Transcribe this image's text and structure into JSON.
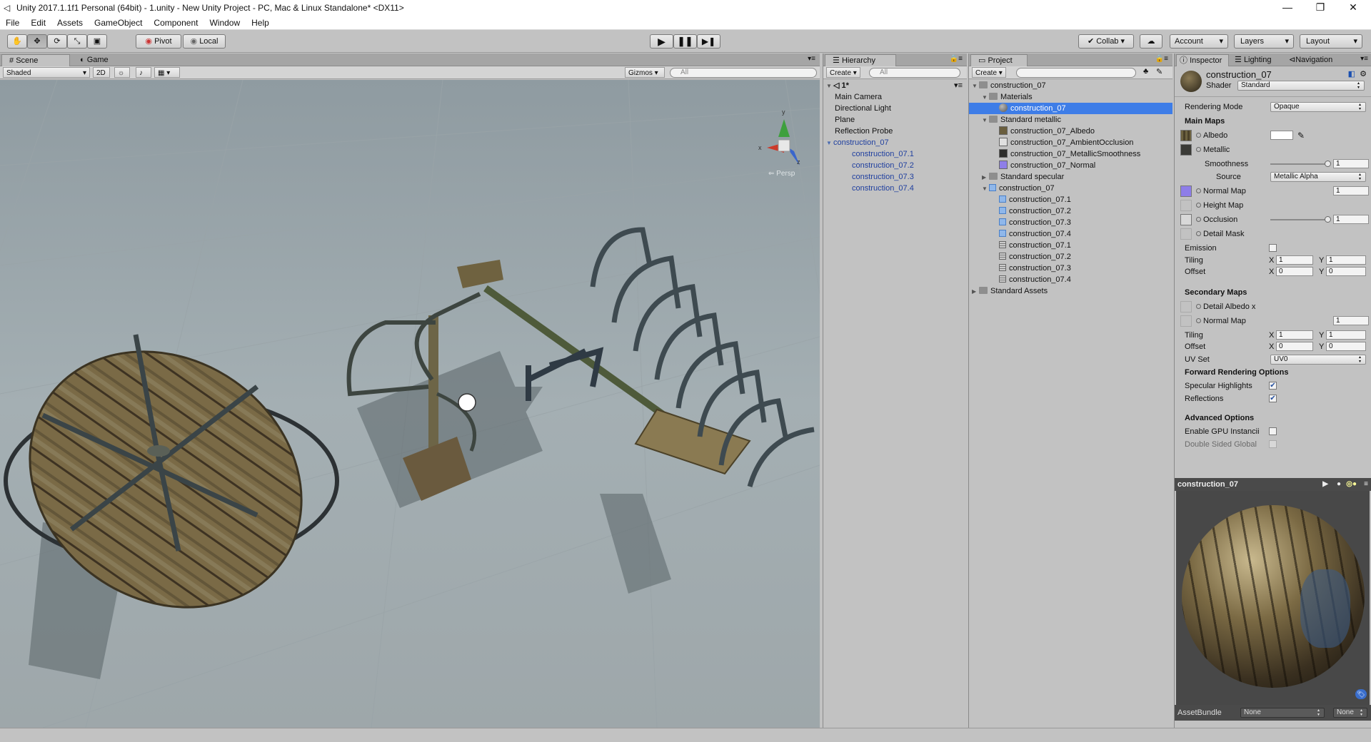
{
  "window": {
    "title": "Unity 2017.1.1f1 Personal (64bit) - 1.unity - New Unity Project - PC, Mac & Linux Standalone* <DX11>",
    "minimize": "—",
    "maximize": "❐",
    "close": "✕"
  },
  "menu": [
    "File",
    "Edit",
    "Assets",
    "GameObject",
    "Component",
    "Window",
    "Help"
  ],
  "toolbar": {
    "pivot": "Pivot",
    "local": "Local",
    "collab": "✔ Collab",
    "account": "Account",
    "layers": "Layers",
    "layout": "Layout"
  },
  "scene": {
    "tab_scene": "Scene",
    "tab_game": "Game",
    "shading": "Shaded",
    "mode_2d": "2D",
    "gizmos": "Gizmos",
    "search_placeholder": "All",
    "persp": "Persp",
    "axis_x": "x",
    "axis_y": "y",
    "axis_z": "z"
  },
  "hierarchy": {
    "tab": "Hierarchy",
    "create": "Create",
    "search_placeholder": "All",
    "scene_name": "1*",
    "items": [
      {
        "label": "Main Camera",
        "blue": false,
        "indent": 1
      },
      {
        "label": "Directional Light",
        "blue": false,
        "indent": 1
      },
      {
        "label": "Plane",
        "blue": false,
        "indent": 1
      },
      {
        "label": "Reflection Probe",
        "blue": false,
        "indent": 1
      },
      {
        "label": "construction_07",
        "blue": true,
        "indent": 1,
        "expanded": true
      },
      {
        "label": "construction_07.1",
        "blue": true,
        "indent": 2
      },
      {
        "label": "construction_07.2",
        "blue": true,
        "indent": 2
      },
      {
        "label": "construction_07.3",
        "blue": true,
        "indent": 2
      },
      {
        "label": "construction_07.4",
        "blue": true,
        "indent": 2
      }
    ]
  },
  "project": {
    "tab": "Project",
    "create": "Create",
    "items": [
      {
        "label": "construction_07",
        "type": "folder",
        "indent": 0,
        "fold": "▼"
      },
      {
        "label": "Materials",
        "type": "folder",
        "indent": 1,
        "fold": "▼"
      },
      {
        "label": "construction_07",
        "type": "material",
        "indent": 2,
        "fold": "",
        "selected": true
      },
      {
        "label": "Standard metallic",
        "type": "folder",
        "indent": 1,
        "fold": "▼"
      },
      {
        "label": "construction_07_Albedo",
        "type": "tex-albedo",
        "indent": 2,
        "fold": ""
      },
      {
        "label": "construction_07_AmbientOcclusion",
        "type": "tex-ao",
        "indent": 2,
        "fold": ""
      },
      {
        "label": "construction_07_MetallicSmoothness",
        "type": "tex-metal",
        "indent": 2,
        "fold": ""
      },
      {
        "label": "construction_07_Normal",
        "type": "tex-normal",
        "indent": 2,
        "fold": ""
      },
      {
        "label": "Standard specular",
        "type": "folder",
        "indent": 1,
        "fold": "▶"
      },
      {
        "label": "construction_07",
        "type": "prefab",
        "indent": 1,
        "fold": "▼"
      },
      {
        "label": "construction_07.1",
        "type": "prefab",
        "indent": 2,
        "fold": ""
      },
      {
        "label": "construction_07.2",
        "type": "prefab",
        "indent": 2,
        "fold": ""
      },
      {
        "label": "construction_07.3",
        "type": "prefab",
        "indent": 2,
        "fold": ""
      },
      {
        "label": "construction_07.4",
        "type": "prefab",
        "indent": 2,
        "fold": ""
      },
      {
        "label": "construction_07.1",
        "type": "mesh",
        "indent": 2,
        "fold": ""
      },
      {
        "label": "construction_07.2",
        "type": "mesh",
        "indent": 2,
        "fold": ""
      },
      {
        "label": "construction_07.3",
        "type": "mesh",
        "indent": 2,
        "fold": ""
      },
      {
        "label": "construction_07.4",
        "type": "mesh",
        "indent": 2,
        "fold": ""
      },
      {
        "label": "Standard Assets",
        "type": "folder",
        "indent": 0,
        "fold": "▶"
      }
    ]
  },
  "inspector": {
    "tab_inspector": "Inspector",
    "tab_lighting": "Lighting",
    "tab_navigation": "Navigation",
    "object_name": "construction_07",
    "shader_label": "Shader",
    "shader_value": "Standard",
    "rendering_mode_label": "Rendering Mode",
    "rendering_mode_value": "Opaque",
    "main_maps": "Main Maps",
    "albedo": "Albedo",
    "metallic": "Metallic",
    "smoothness": "Smoothness",
    "smoothness_value": "1",
    "smoothness_fraction": 1.0,
    "source_label": "Source",
    "source_value": "Metallic Alpha",
    "normal_map": "Normal Map",
    "normal_value": "1",
    "height_map": "Height Map",
    "occlusion": "Occlusion",
    "occlusion_value": "1",
    "occlusion_fraction": 1.0,
    "detail_mask": "Detail Mask",
    "emission": "Emission",
    "tiling": "Tiling",
    "offset": "Offset",
    "x": "X",
    "y": "Y",
    "tiling_x": "1",
    "tiling_y": "1",
    "offset_x": "0",
    "offset_y": "0",
    "secondary_maps": "Secondary Maps",
    "detail_albedo": "Detail Albedo x",
    "sec_normal_map": "Normal Map",
    "sec_normal_value": "1",
    "sec_tiling_x": "1",
    "sec_tiling_y": "1",
    "sec_offset_x": "0",
    "sec_offset_y": "0",
    "uv_set_label": "UV Set",
    "uv_set_value": "UV0",
    "forward_opts": "Forward Rendering Options",
    "specular_highlights": "Specular Highlights",
    "reflections": "Reflections",
    "advanced": "Advanced Options",
    "gpu_instancing": "Enable GPU Instancii",
    "double_sided": "Double Sided Global",
    "preview_title": "construction_07",
    "assetbundle_label": "AssetBundle",
    "assetbundle_value": "None",
    "assetbundle_variant": "None"
  }
}
